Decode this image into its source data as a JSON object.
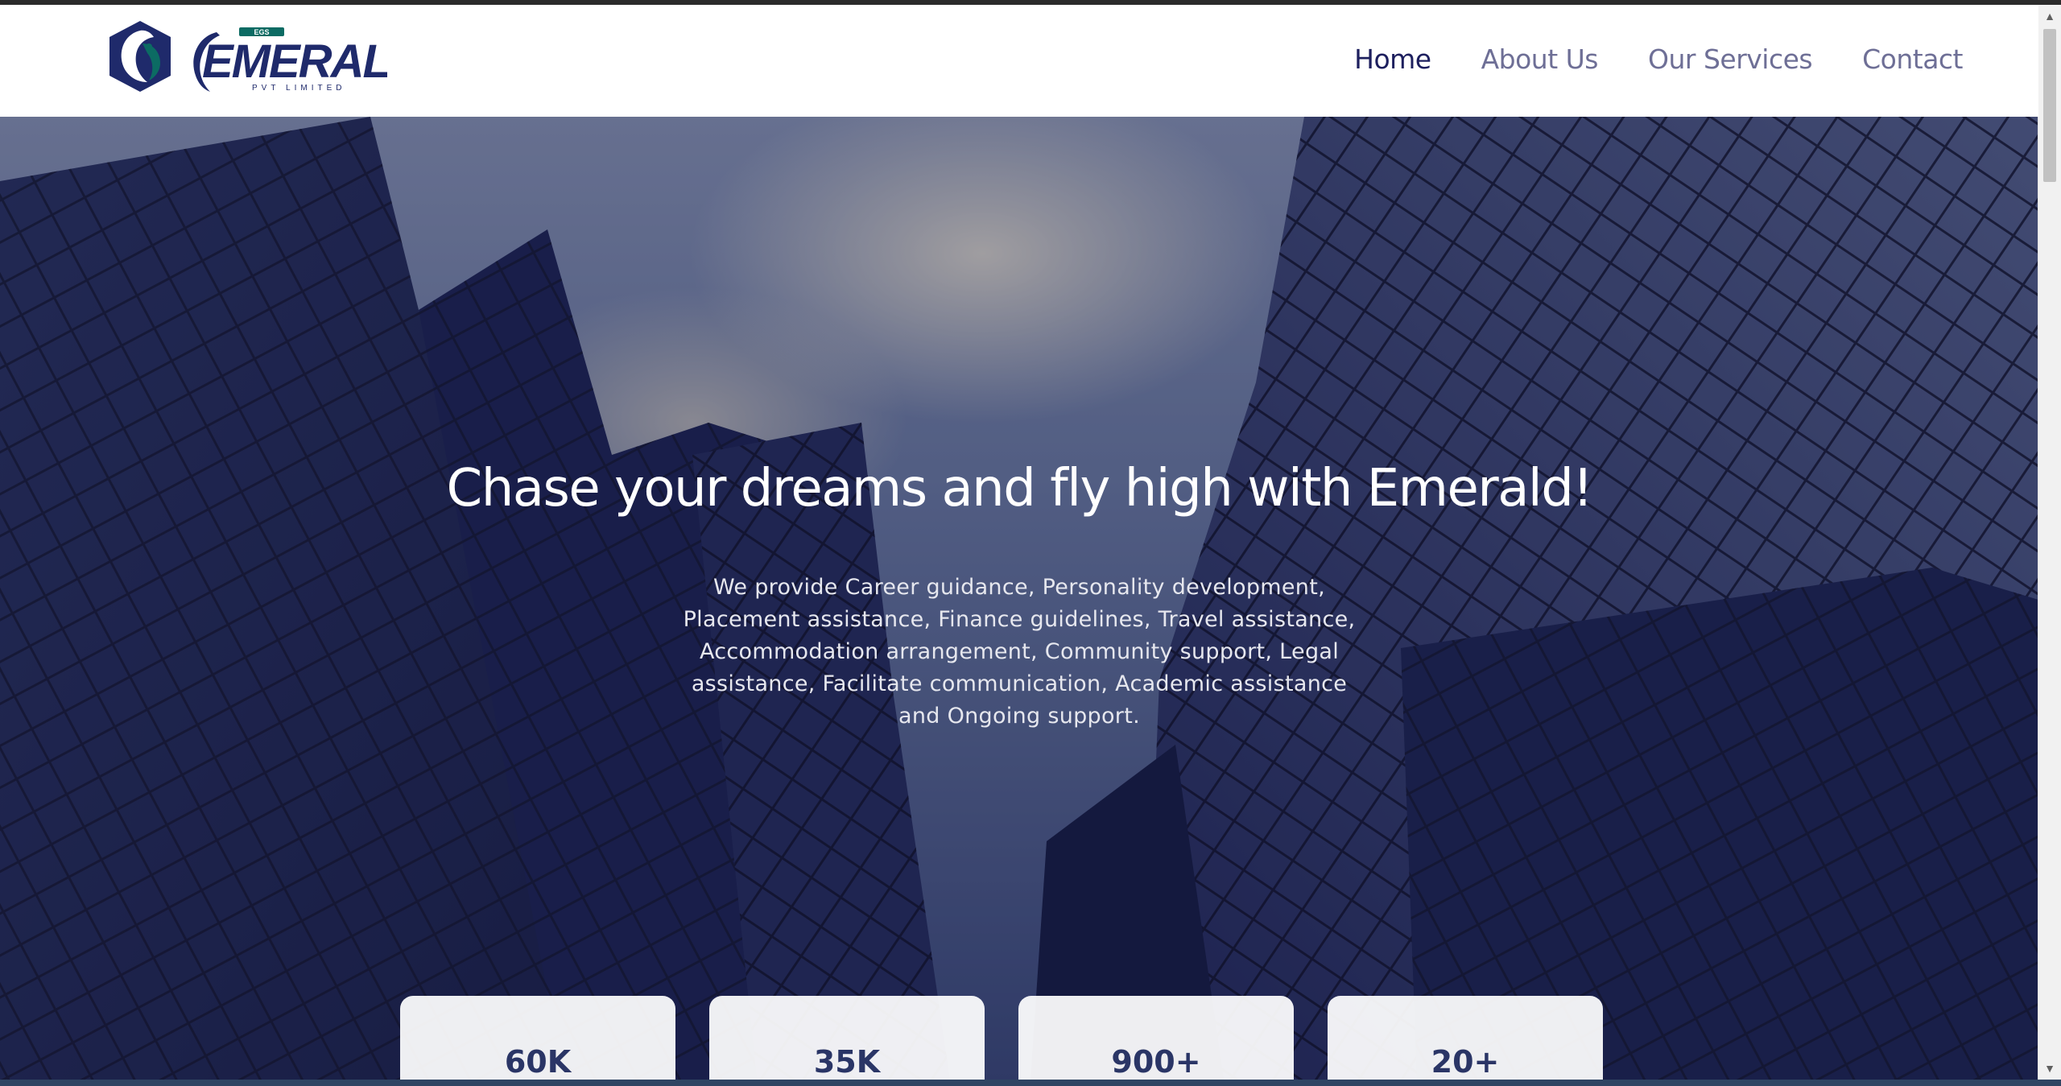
{
  "brand": {
    "name": "EMERALD",
    "badge": "EGS",
    "tagline": "PVT LIMITED"
  },
  "nav": {
    "items": [
      {
        "label": "Home",
        "active": true
      },
      {
        "label": "About Us",
        "active": false
      },
      {
        "label": "Our Services",
        "active": false
      },
      {
        "label": "Contact",
        "active": false
      }
    ]
  },
  "hero": {
    "title": "Chase your dreams and fly high with Emerald!",
    "description": "We provide Career guidance, Personality development, Placement assistance, Finance guidelines, Travel assistance, Accommodation arrangement, Community support, Legal assistance, Facilitate communication, Academic assistance and Ongoing support."
  },
  "stats": [
    {
      "value": "60K"
    },
    {
      "value": "35K"
    },
    {
      "value": "900+"
    },
    {
      "value": "20+"
    }
  ],
  "colors": {
    "nav_active": "#1d1f5e",
    "nav_inactive": "#6e6f96",
    "brand_blue": "#1f2a6b",
    "brand_green": "#0c6b63",
    "stat_text": "#2a3566"
  }
}
